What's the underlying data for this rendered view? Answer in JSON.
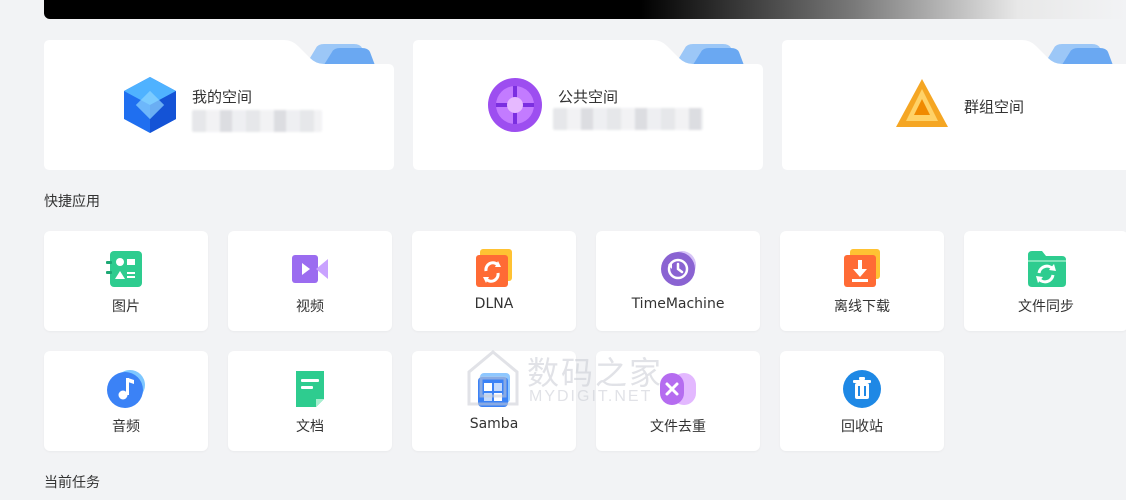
{
  "spaces": [
    {
      "title": "我的空间",
      "icon": "cube-icon"
    },
    {
      "title": "公共空间",
      "icon": "sphere-icon"
    },
    {
      "title": "群组空间",
      "icon": "triangle-icon"
    }
  ],
  "quick_apps_title": "快捷应用",
  "apps": [
    {
      "label": "图片",
      "icon": "photos-icon",
      "color": "#2ecc8f"
    },
    {
      "label": "视频",
      "icon": "video-icon",
      "color": "#9b6cf0"
    },
    {
      "label": "DLNA",
      "icon": "dlna-icon",
      "color": "#ff6b35"
    },
    {
      "label": "TimeMachine",
      "icon": "time-machine-icon",
      "color": "#8a63d2"
    },
    {
      "label": "离线下载",
      "icon": "download-icon",
      "color": "#ff6b35"
    },
    {
      "label": "文件同步",
      "icon": "sync-icon",
      "color": "#2ecc8f"
    },
    {
      "label": "音频",
      "icon": "music-icon",
      "color": "#3b82f6"
    },
    {
      "label": "文档",
      "icon": "document-icon",
      "color": "#2ecc8f"
    },
    {
      "label": "Samba",
      "icon": "samba-icon",
      "color": "#3b82f6"
    },
    {
      "label": "文件去重",
      "icon": "dedupe-icon",
      "color": "#b56cf0"
    },
    {
      "label": "回收站",
      "icon": "recycle-bin-icon",
      "color": "#1e88e5"
    }
  ],
  "current_tasks_title": "当前任务",
  "watermark": {
    "text": "数码之家",
    "url": "MYDIGIT.NET"
  }
}
